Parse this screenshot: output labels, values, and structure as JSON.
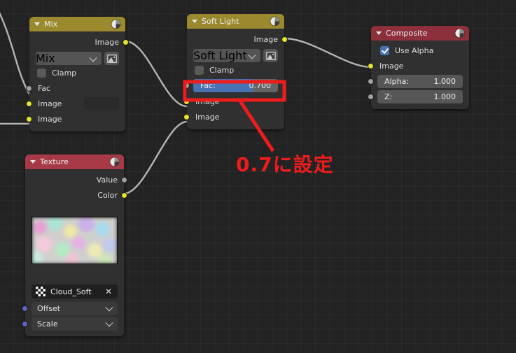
{
  "app": {
    "editor": "blender-compositor-node-editor",
    "background_color": "#232323",
    "grid_color": "#2b2b2b"
  },
  "annotation": {
    "text": "0.7に設定",
    "color": "#ee1c1c",
    "highlight_target": "soft-light-fac-slider"
  },
  "nodes": [
    {
      "id": "mix",
      "title": "Mix",
      "header_color": "#9a8a2d",
      "collapse_icon": "triangle-down-icon",
      "type_icon": "shading-sphere-icon",
      "outputs": [
        {
          "label": "Image",
          "socket": "yellow"
        }
      ],
      "dropdown": {
        "value": "Mix",
        "icon": "image-thumbnail-icon"
      },
      "checkbox": {
        "label": "Clamp",
        "checked": false
      },
      "inputs": [
        {
          "label": "Fac",
          "socket": "grey"
        },
        {
          "label": "Image",
          "socket": "yellow",
          "swatch": "#2a2a2a"
        },
        {
          "label": "Image",
          "socket": "yellow"
        }
      ]
    },
    {
      "id": "soft-light",
      "title": "Soft Light",
      "header_color": "#9a8a2d",
      "collapse_icon": "triangle-down-icon",
      "type_icon": "shading-sphere-icon",
      "outputs": [
        {
          "label": "Image",
          "socket": "yellow"
        }
      ],
      "dropdown": {
        "value": "Soft Light",
        "icon": "image-thumbnail-icon"
      },
      "checkbox": {
        "label": "Clamp",
        "checked": false
      },
      "fac": {
        "label": "Fac:",
        "value": "0.700",
        "fill_percent": 70,
        "socket": "grey"
      },
      "inputs": [
        {
          "label": "Image",
          "socket": "yellow"
        },
        {
          "label": "Image",
          "socket": "yellow"
        }
      ]
    },
    {
      "id": "composite",
      "title": "Composite",
      "header_color": "#8e2f3c",
      "collapse_icon": "triangle-down-icon",
      "type_icon": "shading-sphere-icon",
      "checkbox": {
        "label": "Use Alpha",
        "checked": true
      },
      "inputs": [
        {
          "label": "Image",
          "socket": "yellow"
        },
        {
          "label": "Alpha:",
          "value": "1.000",
          "socket": "grey"
        },
        {
          "label": "Z:",
          "value": "1.000",
          "socket": "grey"
        }
      ]
    },
    {
      "id": "texture",
      "title": "Texture",
      "header_color": "#a83a48",
      "collapse_icon": "triangle-down-icon",
      "type_icon": "shading-sphere-icon",
      "outputs": [
        {
          "label": "Value",
          "socket": "grey"
        },
        {
          "label": "Color",
          "socket": "yellow"
        }
      ],
      "preview": "cloud-noise-preview",
      "datablock": {
        "icon": "checker-texture-icon",
        "name": "Cloud_Soft",
        "clear_icon": "x-icon"
      },
      "inputs": [
        {
          "label": "Offset",
          "socket": "purple",
          "chevron": "chevron-down-icon"
        },
        {
          "label": "Scale",
          "socket": "purple",
          "chevron": "chevron-down-icon"
        }
      ]
    }
  ],
  "links": [
    {
      "from": "mix.image-out",
      "to": "soft-light.image-in-1",
      "color": "#b4b4b4"
    },
    {
      "from": "texture.color-out",
      "to": "soft-light.image-in-2",
      "color": "#b4b4b4"
    },
    {
      "from": "soft-light.image-out",
      "to": "composite.image-in",
      "color": "#b4b4b4"
    },
    {
      "from": "offscreen",
      "to": "mix.fac-in",
      "color": "#b4b4b4"
    },
    {
      "from": "offscreen",
      "to": "mix.image-in-2",
      "color": "#b4b4b4"
    }
  ]
}
